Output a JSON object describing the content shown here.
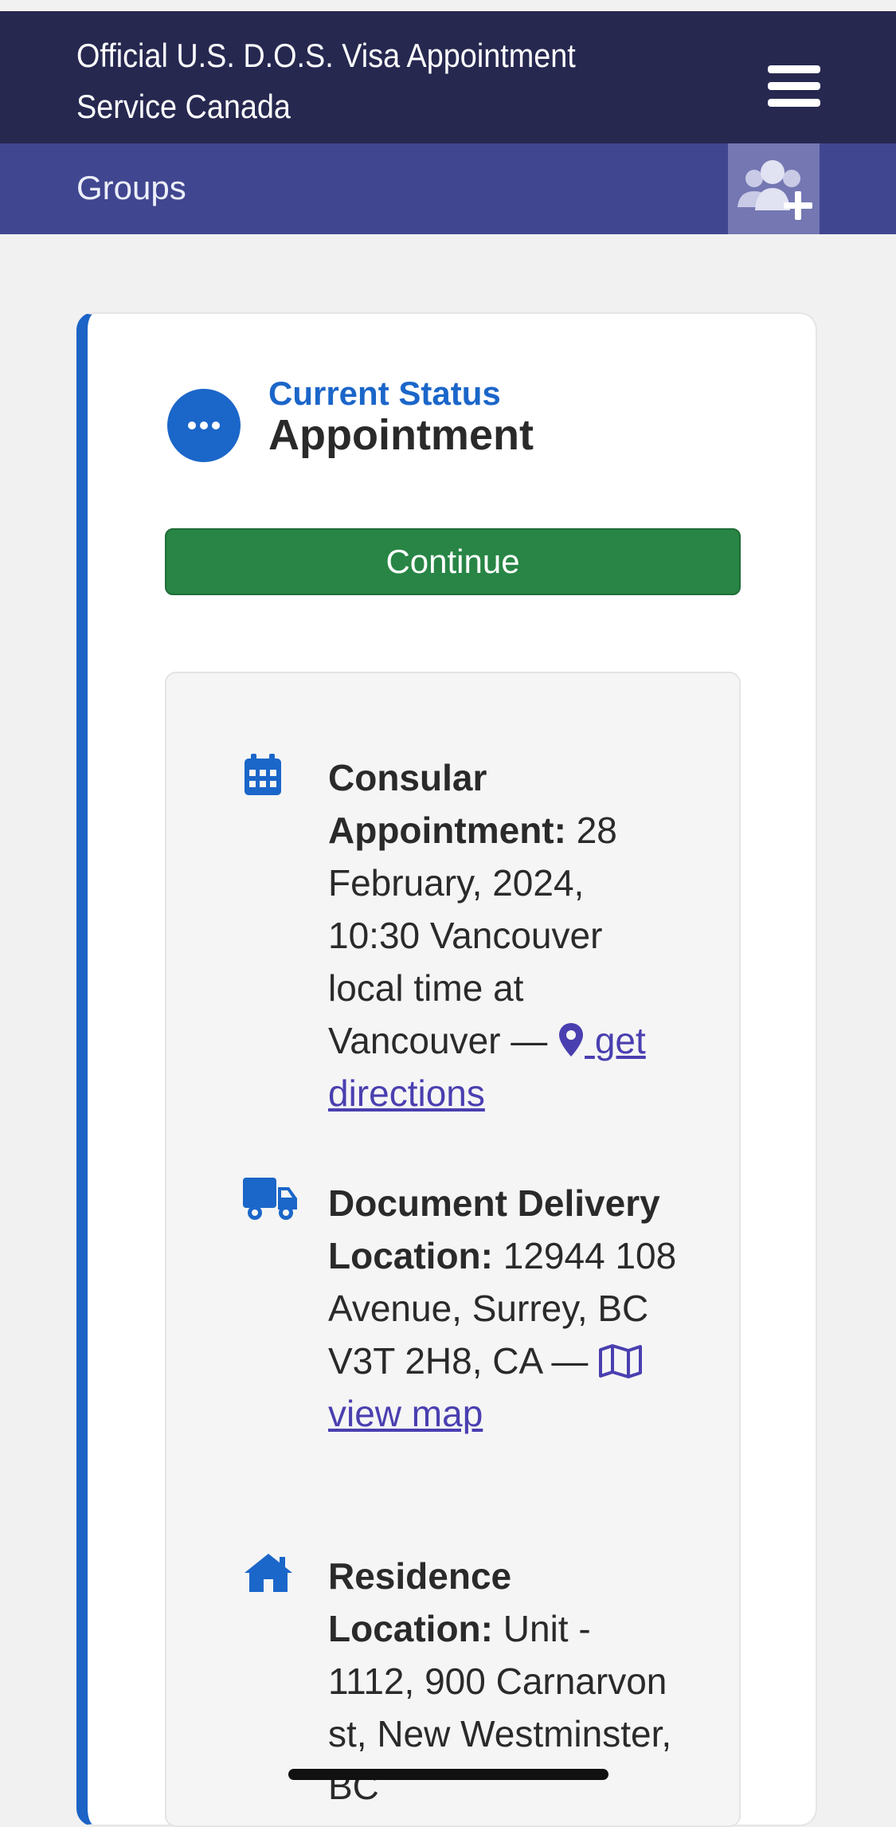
{
  "header": {
    "title": "Official U.S. D.O.S. Visa Appointment Service Canada",
    "menu_icon": "hamburger-menu-icon"
  },
  "subnav": {
    "label": "Groups",
    "add_icon": "add-group-icon"
  },
  "status": {
    "label": "Current Status",
    "value": "Appointment",
    "icon": "ellipsis-icon"
  },
  "continue_label": "Continue",
  "details": {
    "consular": {
      "icon": "calendar-icon",
      "label": "Consular Appointment:",
      "text": "28 February, 2024, 10:30 Vancouver local time at Vancouver —",
      "link_icon": "map-pin-icon",
      "link": "get directions"
    },
    "delivery": {
      "icon": "truck-icon",
      "label": "Document Delivery Location:",
      "text": "12944 108 Avenue, Surrey, BC V3T 2H8, CA —",
      "link_icon": "map-icon",
      "link": "view map"
    },
    "residence": {
      "icon": "home-icon",
      "label": "Residence Location:",
      "text": "Unit - 1112, 900 Carnarvon st, New Westminster, BC"
    }
  },
  "colors": {
    "header_bg": "#262850",
    "subnav_bg": "#414690",
    "accent_blue": "#1b66c9",
    "continue_green": "#288545",
    "link_purple": "#4a3fb0"
  }
}
